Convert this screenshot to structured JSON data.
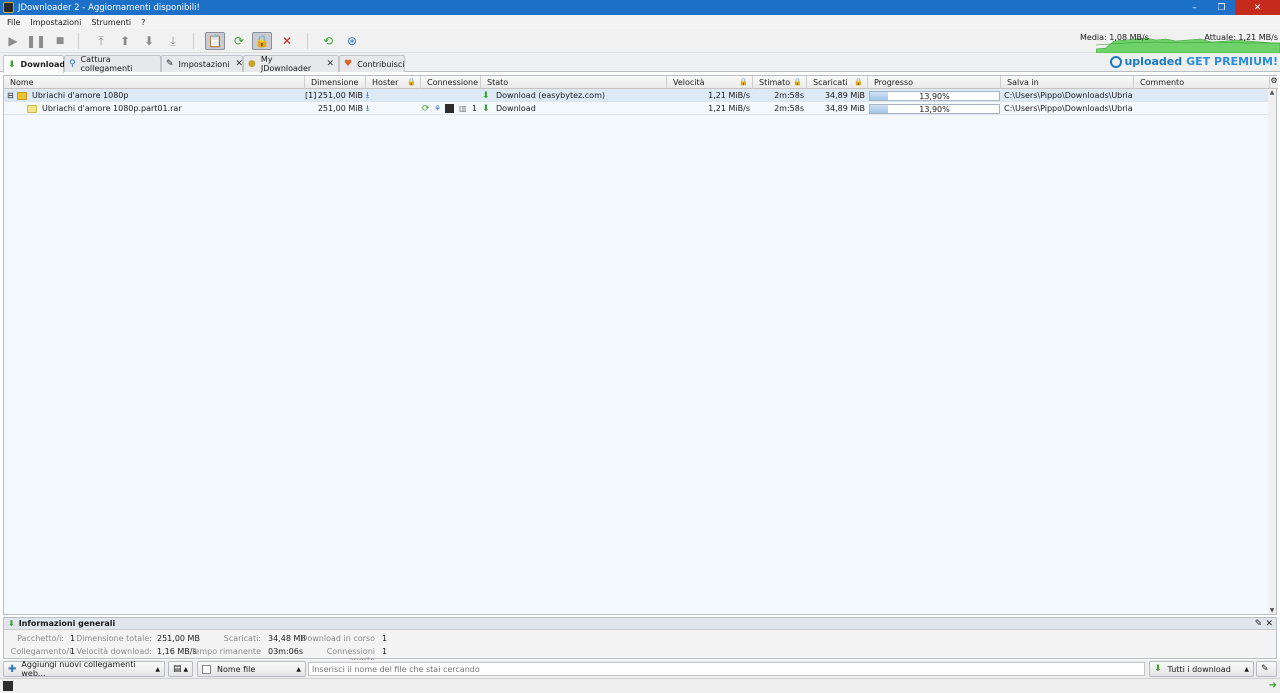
{
  "window": {
    "title": "JDownloader 2 - Aggiornamenti disponibili!",
    "min": "–",
    "max": "❐",
    "close": "✕"
  },
  "menu": [
    "File",
    "Impostazioni",
    "Strumenti",
    "?"
  ],
  "speed": {
    "media": "Media: 1,08 MB/s",
    "attuale": "Attuale: 1,21 MB/s"
  },
  "tabs": [
    {
      "label": "Download"
    },
    {
      "label": "Cattura collegamenti"
    },
    {
      "label": "Impostazioni"
    },
    {
      "label": "My JDownloader"
    },
    {
      "label": "Contribuisci"
    }
  ],
  "premium": {
    "brand": "uploaded",
    "cta": "GET PREMIUM!"
  },
  "columns": [
    "Nome",
    "Dimensione",
    "Hoster",
    "Connessione",
    "Stato",
    "Velocità",
    "Stimato",
    "Scaricati",
    "Progresso",
    "Salva in",
    "Commento"
  ],
  "rows": [
    {
      "expander": "⊟",
      "name": "Ubriachi d'amore 1080p",
      "count": "[1]",
      "size": "251,00 MiB",
      "status": "Download (easybytez.com)",
      "speed": "1,21 MiB/s",
      "eta": "2m:58s",
      "loaded": "34,89 MiB",
      "progress": "13,90%",
      "progress_value": 0.139,
      "save": "C:\\Users\\Pippo\\Downloads\\Ubriach...",
      "connections": ""
    },
    {
      "expander": "",
      "name": "Ubriachi d'amore 1080p.part01.rar",
      "count": "",
      "size": "251,00 MiB",
      "status": "Download",
      "speed": "1,21 MiB/s",
      "eta": "2m:58s",
      "loaded": "34,89 MiB",
      "progress": "13,90%",
      "progress_value": 0.139,
      "save": "C:\\Users\\Pippo\\Downloads\\Ubriach...",
      "connections": "1"
    }
  ],
  "info": {
    "title": "Informazioni generali",
    "pacchetti_label": "Pacchetto/i:",
    "pacchetti": "1",
    "dim_label": "Dimensione totale:",
    "dim": "251,00 MB",
    "scaricati_label": "Scaricati:",
    "scaricati": "34,48 MB",
    "incorso_label": "Download in corso",
    "incorso": "1",
    "coll_label": "Collegamento/i:",
    "coll": "1",
    "vel_label": "Velocità download:",
    "vel": "1,16 MB/s",
    "tempo_label": "Tempo rimanente",
    "tempo": "03m:06s",
    "conn_label": "Connessioni aperte",
    "conn": "1"
  },
  "bottom": {
    "add_links": "Aggiungi nuovi collegamenti web...",
    "filter": "Nome file",
    "search_placeholder": "Inserisci il nome del file che stai cercando",
    "all_downloads": "Tutti i download"
  }
}
